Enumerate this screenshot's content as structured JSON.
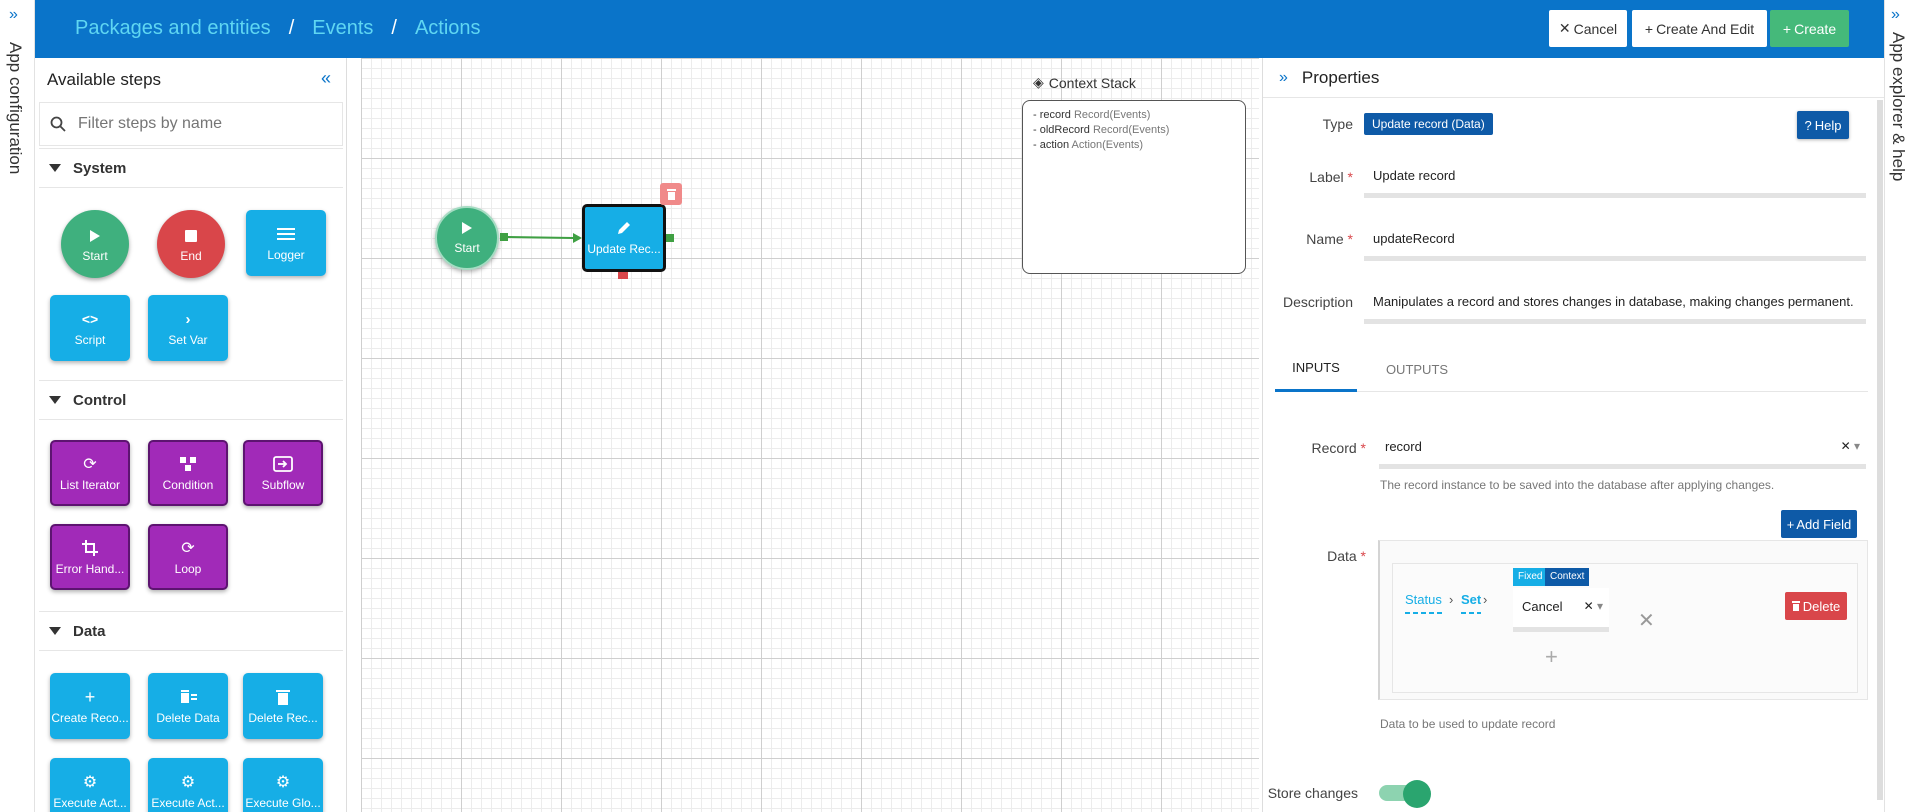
{
  "left_strip": {
    "label": "App configuration"
  },
  "right_strip": {
    "label": "App explorer & help"
  },
  "header": {
    "breadcrumb": [
      "Packages and entities",
      "Events",
      "Actions"
    ],
    "separator": "/",
    "cancel_label": "Cancel",
    "create_edit_label": "Create And Edit",
    "create_label": "Create",
    "colors": {
      "bar": "#0a74c9",
      "create": "#45b97a"
    }
  },
  "steps_panel": {
    "title": "Available steps",
    "filter_placeholder": "Filter steps by name",
    "sections": [
      {
        "name": "System",
        "items": [
          "Start",
          "End",
          "Logger",
          "Script",
          "Set Var"
        ]
      },
      {
        "name": "Control",
        "items": [
          "List Iterator",
          "Condition",
          "Subflow",
          "Error Hand...",
          "Loop"
        ]
      },
      {
        "name": "Data",
        "items": [
          "Create Reco...",
          "Delete Data",
          "Delete Rec...",
          "Execute Act...",
          "Execute Act...",
          "Execute Glo..."
        ]
      }
    ]
  },
  "canvas": {
    "start_label": "Start",
    "update_label": "Update Rec...",
    "context_stack": {
      "title": "Context Stack",
      "entries": [
        {
          "name": "record",
          "type": "Record(Events)"
        },
        {
          "name": "oldRecord",
          "type": "Record(Events)"
        },
        {
          "name": "action",
          "type": "Action(Events)"
        }
      ]
    }
  },
  "properties": {
    "title": "Properties",
    "type_label": "Type",
    "type_value": "Update record (Data)",
    "help_label": "Help",
    "label_label": "Label",
    "label_value": "Update record",
    "name_label": "Name",
    "name_value": "updateRecord",
    "description_label": "Description",
    "description_value": "Manipulates a record and stores changes in database, making changes permanent.",
    "tabs": [
      "INPUTS",
      "OUTPUTS"
    ],
    "active_tab": "INPUTS",
    "record_label": "Record",
    "record_value": "record",
    "record_hint": "The record instance to be saved into the database after applying changes.",
    "add_field_label": "Add Field",
    "data_label": "Data",
    "data_path": [
      "Status",
      "Set"
    ],
    "fixed_label": "Fixed",
    "context_label": "Context",
    "data_value": "Cancel",
    "delete_label": "Delete",
    "data_hint": "Data to be used to update record",
    "store_changes_label": "Store changes",
    "store_changes_on": true
  }
}
